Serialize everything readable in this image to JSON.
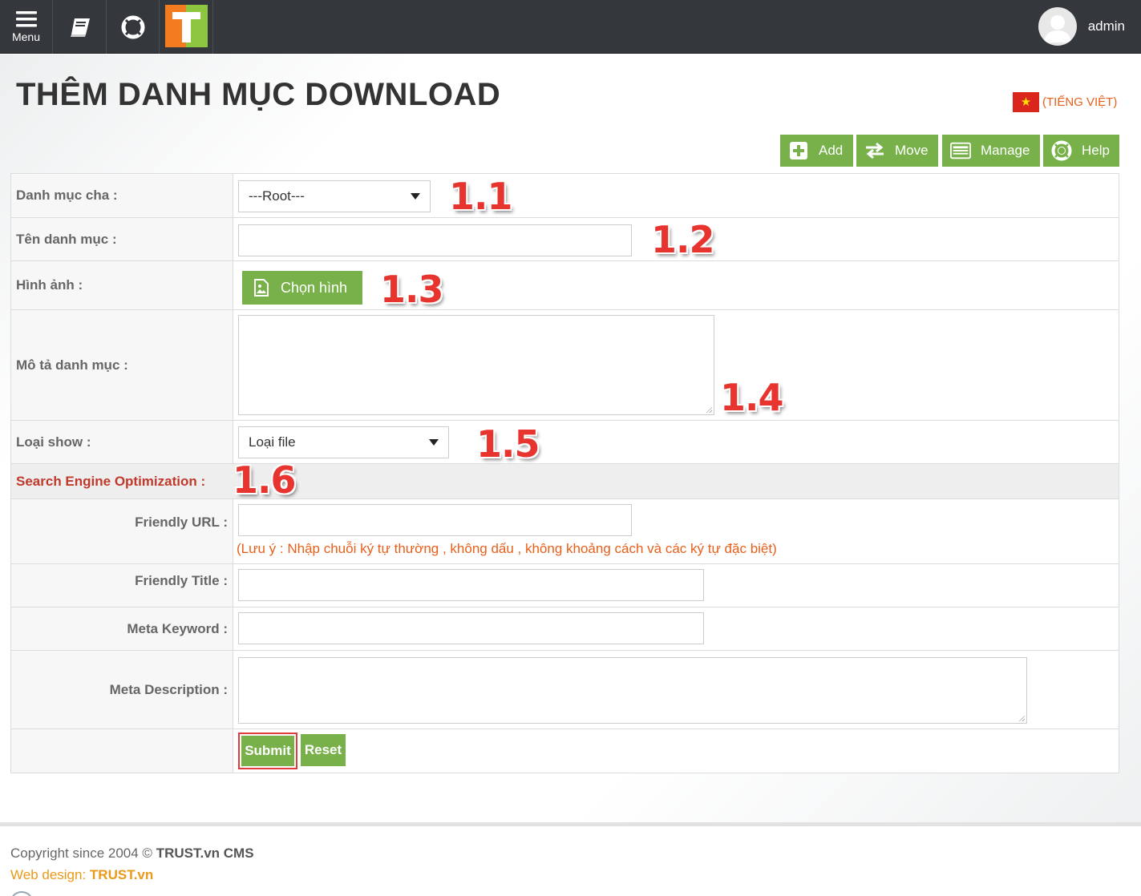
{
  "topbar": {
    "menu_label": "Menu",
    "logo_letter": "T",
    "username": "admin"
  },
  "page": {
    "title": "THÊM DANH MỤC DOWNLOAD",
    "language": "(TIẾNG VIỆT)",
    "flag_star": "★"
  },
  "actions": [
    {
      "label": "Add",
      "icon": "plus-icon"
    },
    {
      "label": "Move",
      "icon": "swap-arrows-icon"
    },
    {
      "label": "Manage",
      "icon": "list-icon"
    },
    {
      "label": "Help",
      "icon": "lifebuoy-icon"
    }
  ],
  "form": {
    "parent_label": "Danh mục cha :",
    "parent_value": "---Root---",
    "name_label": "Tên danh mục :",
    "name_value": "",
    "image_label": "Hình ảnh :",
    "image_button": "Chọn hình",
    "desc_label": "Mô tả danh mục :",
    "show_label": "Loại show :",
    "show_value": "Loại file",
    "seo_heading": "Search Engine Optimization :",
    "friendly_url_label": "Friendly URL :",
    "friendly_url_note": "(Lưu ý : Nhập chuỗi ký tự thường , không dấu , không khoảng cách và các ký tự đặc biệt)",
    "friendly_title_label": "Friendly Title :",
    "meta_keyword_label": "Meta Keyword :",
    "meta_description_label": "Meta Description :",
    "submit_label": "Submit",
    "reset_label": "Reset"
  },
  "annotations": [
    "1.1",
    "1.2",
    "1.3",
    "1.4",
    "1.5",
    "1.6"
  ],
  "footer": {
    "copyright_prefix": "Copyright since 2004 © ",
    "copyright_brand": "TRUST.vn CMS",
    "webdesign_prefix": "Web design: ",
    "webdesign_brand": "TRUST.vn"
  },
  "colors": {
    "topbar": "#34373b",
    "green": "#78b14a",
    "orange": "#e7601b",
    "seo_red": "#c0392b",
    "annotation_red": "#e8342f"
  }
}
